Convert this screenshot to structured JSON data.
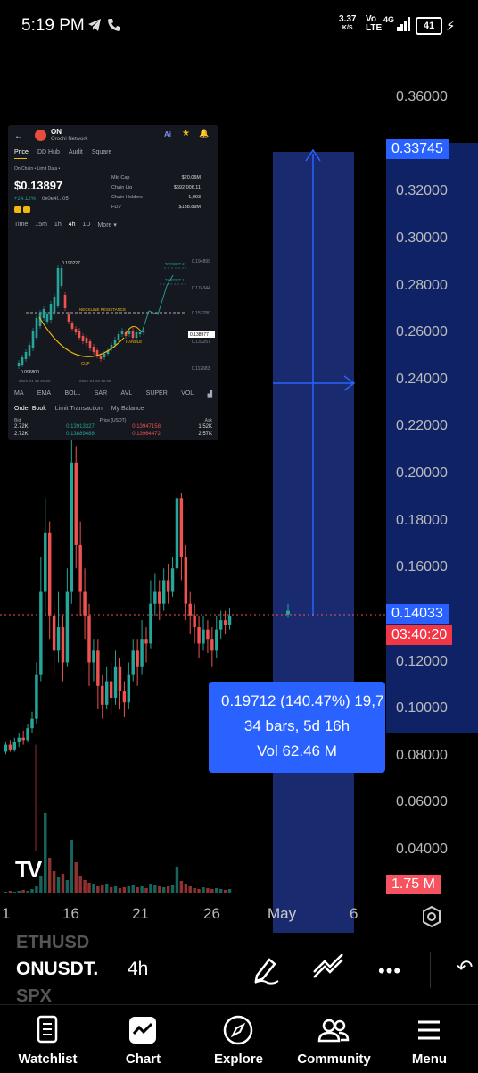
{
  "status": {
    "time": "5:19 PM",
    "net_speed": "3.37",
    "net_unit": "K/S",
    "volte_top": "Vo",
    "volte_bottom": "LTE",
    "network": "4G",
    "battery": "41"
  },
  "chart": {
    "price_axis": [
      "0.36000",
      "0.32000",
      "0.30000",
      "0.28000",
      "0.26000",
      "0.24000",
      "0.22000",
      "0.20000",
      "0.18000",
      "0.16000",
      "0.14000",
      "0.12000",
      "0.10000",
      "0.08000",
      "0.06000",
      "0.04000"
    ],
    "target_price": "0.33745",
    "current_price": "0.14033",
    "countdown": "03:40:20",
    "volume_tag": "1.75 M",
    "date_axis": [
      "1",
      "16",
      "21",
      "26",
      "May",
      "6"
    ],
    "measure": {
      "line1": "0.19712 (140.47%) 19,7",
      "line2": "34 bars, 5d 16h",
      "line3": "Vol 62.46 M"
    },
    "logo": "TV",
    "colors": {
      "up": "#26a69a",
      "down": "#ef5350",
      "accent": "#2962ff"
    }
  },
  "inset": {
    "symbol": "ON",
    "name": "Orochi Network",
    "tabs": [
      "Price",
      "DD Hub",
      "Audit",
      "Square"
    ],
    "sub": "On Chain • Limit Data •",
    "price": "$0.13897",
    "change": "+24.12%",
    "contract": "0x0e4f...05",
    "stats": [
      {
        "label": "Mkt Cap",
        "value": "$20.05M"
      },
      {
        "label": "Chain Liq",
        "value": "$692,006.11"
      },
      {
        "label": "Chain Holders",
        "value": "1,903"
      },
      {
        "label": "FDV",
        "value": "$138.89M"
      }
    ],
    "timeframes": [
      "Time",
      "15m",
      "1h",
      "4h",
      "1D",
      "More ▾"
    ],
    "right_axis": [
      "0.194899",
      "0.174344",
      "0.153780",
      "0.138977",
      "0.133257",
      "0.112683",
      "0.092129"
    ],
    "annotations": {
      "high": "0.190227",
      "low": "0.096800",
      "neckline": "NECKLINE RESISTANCE",
      "target2": "TARGET 2",
      "target1": "TARGET 1",
      "cup": "CUP",
      "handle": "HANDLE",
      "date1": "2026-04-22 01:00",
      "date2": "2026-04-30 05:00"
    },
    "indicators": [
      "MA",
      "EMA",
      "BOLL",
      "SAR",
      "AVL",
      "SUPER",
      "VOL"
    ],
    "book_tabs": [
      "Order Book",
      "Limit Transaction",
      "My Balance"
    ],
    "book_header": {
      "bid": "Bid",
      "price": "Price (USDT)",
      "ask": "Ask"
    },
    "book_rows": [
      {
        "bid": "2.72K",
        "p1": "0.13913327",
        "p2": "0.13947158",
        "ask": "1.52K"
      },
      {
        "bid": "2.72K",
        "p1": "0.13889488",
        "p2": "0.13964472",
        "ask": "2.57K"
      }
    ]
  },
  "toolbar": {
    "prev_symbol": "ETHUSD",
    "symbol": "ONUSDT.",
    "next_symbol": "SPX",
    "interval": "4h"
  },
  "nav": {
    "items": [
      "Watchlist",
      "Chart",
      "Explore",
      "Community",
      "Menu"
    ]
  }
}
